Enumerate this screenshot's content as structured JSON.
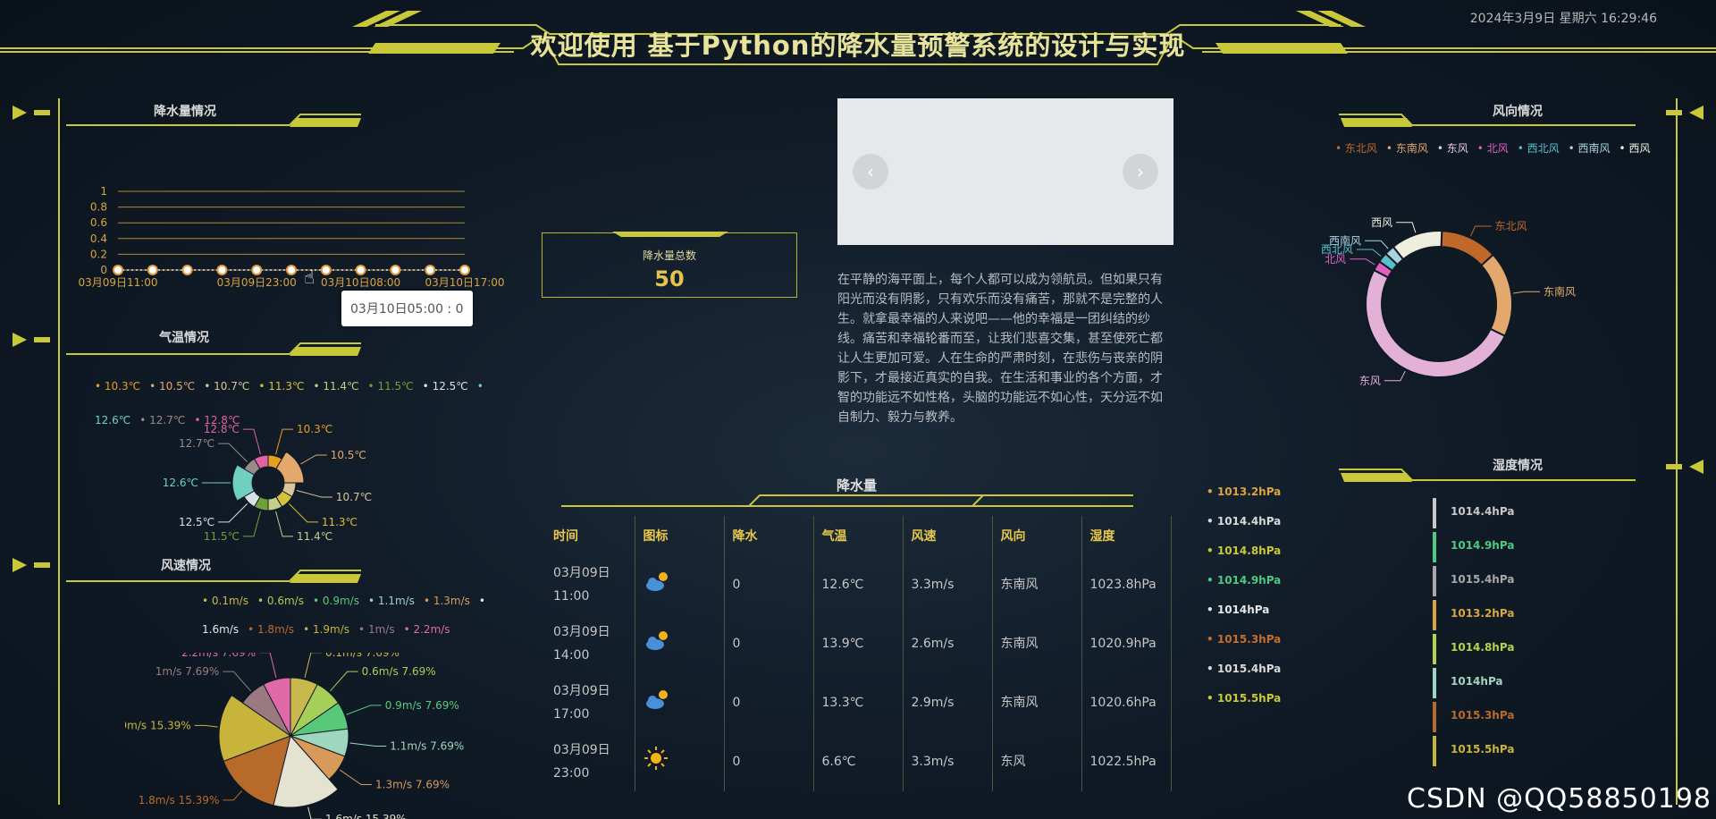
{
  "header": {
    "title": "欢迎使用 基于Python的降水量预警系统的设计与实现",
    "datetime": "2024年3月9日 星期六 16:29:46"
  },
  "colors": {
    "accent": "#c8c83a",
    "line": "#d9a441"
  },
  "rainfall_panel": {
    "title": "降水量情况",
    "tooltip": "03月10日05:00 : 0"
  },
  "temperature_panel": {
    "title": "气温情况",
    "legend": [
      {
        "label": "10.3℃",
        "color": "#e6a020"
      },
      {
        "label": "10.5℃",
        "color": "#e3a86b"
      },
      {
        "label": "10.7℃",
        "color": "#d8c79a"
      },
      {
        "label": "11.3℃",
        "color": "#d6c236"
      },
      {
        "label": "11.4℃",
        "color": "#c3d08a"
      },
      {
        "label": "11.5℃",
        "color": "#6fa13a"
      },
      {
        "label": "12.5℃",
        "color": "#e0e0e0"
      },
      {
        "label": "12.6℃",
        "color": "#6fd0c0"
      },
      {
        "label": "12.7℃",
        "color": "#9a8a86"
      },
      {
        "label": "12.8℃",
        "color": "#e062a2"
      }
    ]
  },
  "wind_speed_panel": {
    "title": "风速情况",
    "legend": [
      {
        "label": "0.1m/s",
        "color": "#c9b84a"
      },
      {
        "label": "0.6m/s",
        "color": "#a6cf5a"
      },
      {
        "label": "0.9m/s",
        "color": "#59c87a"
      },
      {
        "label": "1.1m/s",
        "color": "#9ed6c0"
      },
      {
        "label": "1.3m/s",
        "color": "#d89a5a"
      },
      {
        "label": "1.6m/s",
        "color": "#e8e8e8"
      },
      {
        "label": "1.8m/s",
        "color": "#b86a2a"
      },
      {
        "label": "1.9m/s",
        "color": "#c8b43a"
      },
      {
        "label": "1m/s",
        "color": "#9a7a80"
      },
      {
        "label": "2.2m/s",
        "color": "#e06aa8"
      }
    ]
  },
  "center": {
    "total_label": "降水量总数",
    "total_value": "50",
    "carousel_prev": "‹",
    "carousel_next": "›",
    "article": "在平静的海平面上，每个人都可以成为领航员。但如果只有阳光而没有阴影，只有欢乐而没有痛苦，那就不是完整的人生。就拿最幸福的人来说吧——他的幸福是一团纠结的纱线。痛苦和幸福轮番而至，让我们悲喜交集，甚至使死亡都让人生更加可爱。人在生命的严肃时刻，在悲伤与丧亲的阴影下，才最接近真实的自我。在生活和事业的各个方面，才智的功能远不如性格，头脑的功能远不如心性，天分远不如自制力、毅力与教养。"
  },
  "rain_table": {
    "title": "降水量",
    "headers": [
      "时间",
      "图标",
      "降水",
      "气温",
      "风速",
      "风向",
      "湿度"
    ],
    "rows": [
      {
        "time": "03月09日11:00",
        "icon": "cloud-sun",
        "rain": "0",
        "temp": "12.6℃",
        "wind": "3.3m/s",
        "dir": "东南风",
        "humidity": "1023.8hPa"
      },
      {
        "time": "03月09日14:00",
        "icon": "cloud-sun",
        "rain": "0",
        "temp": "13.9℃",
        "wind": "2.6m/s",
        "dir": "东南风",
        "humidity": "1020.9hPa"
      },
      {
        "time": "03月09日17:00",
        "icon": "cloud-sun",
        "rain": "0",
        "temp": "13.3℃",
        "wind": "2.9m/s",
        "dir": "东南风",
        "humidity": "1020.6hPa"
      },
      {
        "time": "03月09日23:00",
        "icon": "sun",
        "rain": "0",
        "temp": "6.6℃",
        "wind": "3.3m/s",
        "dir": "东风",
        "humidity": "1022.5hPa"
      }
    ]
  },
  "pressure_list": [
    {
      "label": "1013.2hPa",
      "color": "#d9a441"
    },
    {
      "label": "1014.4hPa",
      "color": "#d8d8d8"
    },
    {
      "label": "1014.8hPa",
      "color": "#c8c83a"
    },
    {
      "label": "1014.9hPa",
      "color": "#4fc880"
    },
    {
      "label": "1014hPa",
      "color": "#e6e6e6"
    },
    {
      "label": "1015.3hPa",
      "color": "#c0702a"
    },
    {
      "label": "1015.4hPa",
      "color": "#d8d8d8"
    },
    {
      "label": "1015.5hPa",
      "color": "#c8c83a"
    }
  ],
  "wind_direction_panel": {
    "title": "风向情况",
    "legend": [
      {
        "label": "东北风",
        "color": "#c0682a"
      },
      {
        "label": "东南风",
        "color": "#e3a86b"
      },
      {
        "label": "东风",
        "color": "#e8c8e8"
      },
      {
        "label": "北风",
        "color": "#e060c0"
      },
      {
        "label": "西北风",
        "color": "#56c0cc"
      },
      {
        "label": "西南风",
        "color": "#a8d4e0"
      },
      {
        "label": "西风",
        "color": "#f0efe2"
      }
    ],
    "slices": [
      {
        "label": "东北风",
        "value": 2,
        "color": "#c0682a"
      },
      {
        "label": "东南风",
        "value": 3,
        "color": "#e3a86b"
      },
      {
        "label": "东风",
        "value": 8,
        "color": "#e3b0d8"
      },
      {
        "label": "北风",
        "value": 0.35,
        "color": "#e060c0"
      },
      {
        "label": "西北风",
        "value": 0.35,
        "color": "#56c0cc"
      },
      {
        "label": "西南风",
        "value": 0.35,
        "color": "#a8d4e0"
      },
      {
        "label": "西风",
        "value": 1.8,
        "color": "#efedde"
      }
    ]
  },
  "humidity_panel": {
    "title": "湿度情况",
    "items": [
      {
        "label": "1014.4hPa",
        "color": "#c8c8c8"
      },
      {
        "label": "1014.9hPa",
        "color": "#4fc880"
      },
      {
        "label": "1015.4hPa",
        "color": "#a8a8a8"
      },
      {
        "label": "1013.2hPa",
        "color": "#d9a441"
      },
      {
        "label": "1014.8hPa",
        "color": "#b8d050"
      },
      {
        "label": "1014hPa",
        "color": "#9ed6c0"
      },
      {
        "label": "1015.3hPa",
        "color": "#b86a2a"
      },
      {
        "label": "1015.5hPa",
        "color": "#c8b43a"
      }
    ]
  },
  "chart_data": [
    {
      "type": "line",
      "x": [
        "03月09日11:00",
        "03月09日14:00",
        "03月09日17:00",
        "03月09日20:00",
        "03月09日23:00",
        "03月10日02:00",
        "03月10日05:00",
        "03月10日08:00",
        "03月10日11:00",
        "03月10日14:00",
        "03月10日17:00"
      ],
      "xticks": [
        "03月09日11:00",
        "03月09日23:00",
        "03月10日08:00",
        "03月10日17:00"
      ],
      "yticks": [
        "0",
        "0.2",
        "0.4",
        "0.6",
        "0.8",
        "1"
      ],
      "ylim": [
        0,
        1
      ],
      "series": [
        {
          "values": [
            0,
            0,
            0,
            0,
            0,
            0,
            0,
            0,
            0,
            0,
            0
          ]
        }
      ]
    },
    {
      "type": "pie",
      "rose": true,
      "labels": [
        "10.3℃",
        "10.5℃",
        "10.7℃",
        "11.3℃",
        "11.4℃",
        "11.5℃",
        "12.5℃",
        "12.6℃",
        "12.7℃",
        "12.8℃"
      ],
      "values": [
        1,
        2,
        1,
        1,
        1,
        1,
        1,
        2,
        1,
        1
      ],
      "colors": [
        "#e6a020",
        "#e3a86b",
        "#d8c79a",
        "#d6c236",
        "#c3d08a",
        "#6fa13a",
        "#d8e0e8",
        "#6fd0c0",
        "#9a8a86",
        "#e062a2"
      ]
    },
    {
      "type": "pie",
      "rose": true,
      "labels": [
        "0.1m/s 7.69%",
        "0.6m/s 7.69%",
        "0.9m/s 7.69%",
        "1.1m/s 7.69%",
        "1.3m/s 7.69%",
        "1.6m/s 15.39%",
        "1.8m/s 15.39%",
        "1.9m/s 15.39%",
        "1m/s 7.69%",
        "2.2m/s 7.69%"
      ],
      "values": [
        7.69,
        7.69,
        7.69,
        7.69,
        7.69,
        15.39,
        15.39,
        15.39,
        7.69,
        7.69
      ],
      "colors": [
        "#c9b84a",
        "#a6cf5a",
        "#59c87a",
        "#9ed6c0",
        "#d89a5a",
        "#e4e2d0",
        "#b86a2a",
        "#c8b43a",
        "#9a7a80",
        "#e06aa8"
      ]
    },
    {
      "type": "pie",
      "donut": true,
      "labels": [
        "东北风",
        "东南风",
        "东风",
        "北风",
        "西北风",
        "西南风",
        "西风"
      ],
      "values": [
        2,
        3,
        8,
        0.35,
        0.35,
        0.35,
        1.8
      ]
    }
  ]
}
